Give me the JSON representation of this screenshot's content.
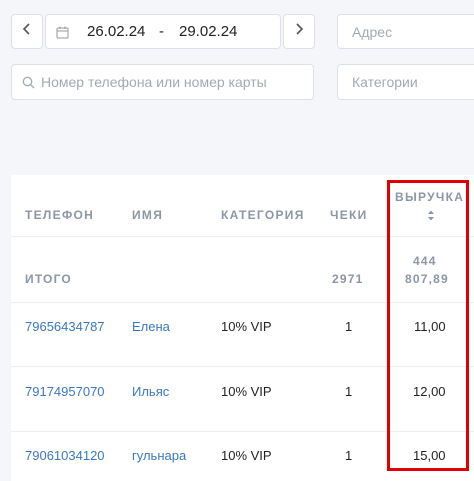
{
  "filters": {
    "prev_icon": "chevron-left-icon",
    "next_icon": "chevron-right-icon",
    "date_from": "26.02.24",
    "date_sep": "-",
    "date_to": "29.02.24",
    "address_placeholder": "Адрес",
    "search_placeholder": "Номер телефона или номер карты",
    "category_placeholder": "Категории"
  },
  "table": {
    "columns": [
      "ТЕЛЕФОН",
      "ИМЯ",
      "КАТЕГОРИЯ",
      "ЧЕКИ",
      "ВЫРУЧКА"
    ],
    "sort_icon": "sort-icon",
    "total": {
      "label": "ИТОГО",
      "checks": "2971",
      "revenue_line1": "444",
      "revenue_line2": "807,89"
    },
    "rows": [
      {
        "phone": "79656434787",
        "name": "Елена",
        "category": "10% VIP",
        "checks": "1",
        "revenue": "11,00"
      },
      {
        "phone": "79174957070",
        "name": "Ильяс",
        "category": "10% VIP",
        "checks": "1",
        "revenue": "12,00"
      },
      {
        "phone": "79061034120",
        "name": "гульнара",
        "category": "10% VIP",
        "checks": "1",
        "revenue": "15,00"
      }
    ]
  },
  "annotation_color": "#e00000"
}
